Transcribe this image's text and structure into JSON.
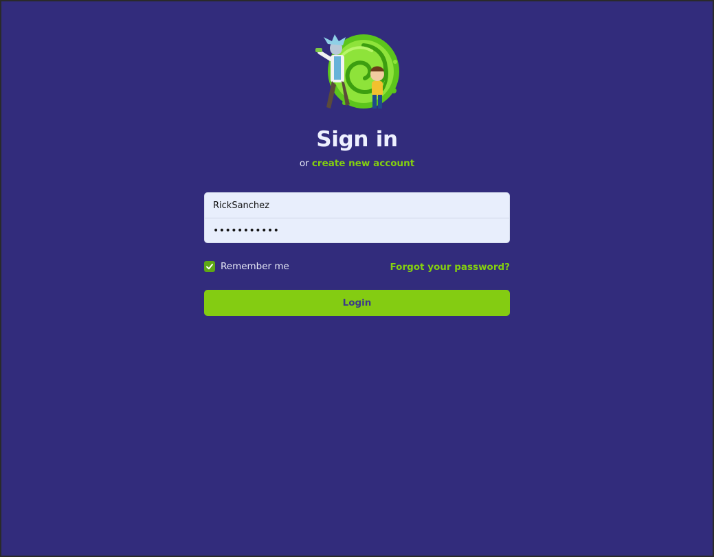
{
  "logo": {
    "icon": "rick-and-morty-portal-logo"
  },
  "heading": {
    "title": "Sign in",
    "prefix": "or",
    "link": "create new account"
  },
  "form": {
    "username_value": "RickSanchez",
    "password_value": "•••••••••••"
  },
  "remember": {
    "label": "Remember me",
    "checked": true
  },
  "forgot_label": "Forgot your password?",
  "login_label": "Login",
  "colors": {
    "background": "#322c7c",
    "accent": "#84cc12",
    "input_bg": "#e8eefc"
  }
}
